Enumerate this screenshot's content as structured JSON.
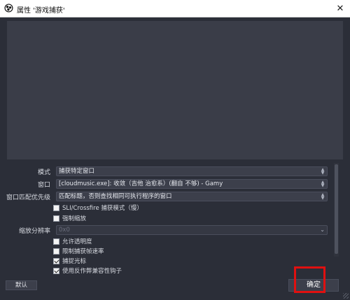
{
  "window": {
    "title": "属性 '游戏捕获'",
    "close_glyph": "✕"
  },
  "properties": {
    "mode": {
      "label": "模式",
      "value": "捕获特定窗口"
    },
    "window": {
      "label": "窗口",
      "value": "[cloudmusic.exe]: 收敛（吉他 治愈系）(翻自 不够) - Gamy"
    },
    "priority": {
      "label": "窗口匹配优先级",
      "value": "匹配标题，否则查找相同可执行程序的窗口"
    },
    "sli_crossfire": {
      "label": "SLI/Crossfire 捕获模式（慢）",
      "checked": false
    },
    "force_scaling": {
      "label": "强制缩放",
      "checked": false
    },
    "scale_resolution": {
      "label": "缩放分辨率",
      "value": "0x0",
      "disabled": true
    },
    "allow_transparency": {
      "label": "允许透明度",
      "checked": false
    },
    "limit_framerate": {
      "label": "限制捕获帧速率",
      "checked": false
    },
    "capture_cursor": {
      "label": "捕捉光标",
      "checked": true
    },
    "anti_cheat_hook": {
      "label": "使用反作弊兼容性钩子",
      "checked": true
    }
  },
  "buttons": {
    "defaults": "默认",
    "ok": "确定"
  },
  "colors": {
    "background": "#2b2e38",
    "preview": "#3a3d48",
    "highlight": "#e01010"
  }
}
